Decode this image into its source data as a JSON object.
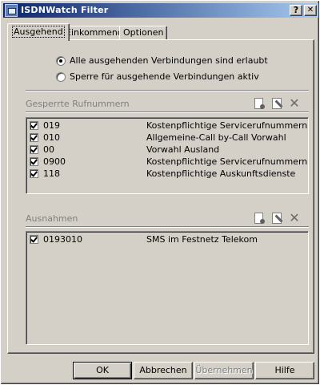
{
  "window": {
    "title": "ISDNWatch Filter",
    "help_label": "?",
    "close_label": "✕"
  },
  "tabs": [
    {
      "label": "Ausgehend",
      "active": true
    },
    {
      "label": "Einkommend",
      "active": false
    },
    {
      "label": "Optionen",
      "active": false
    }
  ],
  "options": {
    "allow_all": "Alle ausgehenden Verbindungen sind erlaubt",
    "block_active": "Sperre für ausgehende Verbindungen aktiv",
    "selected": "allow_all"
  },
  "blocked": {
    "label": "Gesperrte Rufnummern",
    "rows": [
      {
        "code": "019",
        "desc": "Kostenpflichtige Servicerufnummern",
        "checked": true
      },
      {
        "code": "010",
        "desc": "Allgemeine-Call by-Call Vorwahl",
        "checked": true
      },
      {
        "code": "00",
        "desc": "Vorwahl Ausland",
        "checked": true
      },
      {
        "code": "0900",
        "desc": "Kostenpflichtige Servicerufnummern",
        "checked": true
      },
      {
        "code": "118",
        "desc": "Kostenpflichtige Auskunftsdienste",
        "checked": true
      }
    ]
  },
  "exceptions": {
    "label": "Ausnahmen",
    "rows": [
      {
        "code": "0193010",
        "desc": "SMS im Festnetz Telekom",
        "checked": true
      }
    ]
  },
  "icons": {
    "new": "new-item-icon",
    "edit": "edit-item-icon",
    "delete": "delete-item-icon",
    "delete_glyph": "✕"
  },
  "buttons": {
    "ok": "OK",
    "cancel": "Abbrechen",
    "apply": "Übernehmen",
    "help": "Hilfe"
  }
}
